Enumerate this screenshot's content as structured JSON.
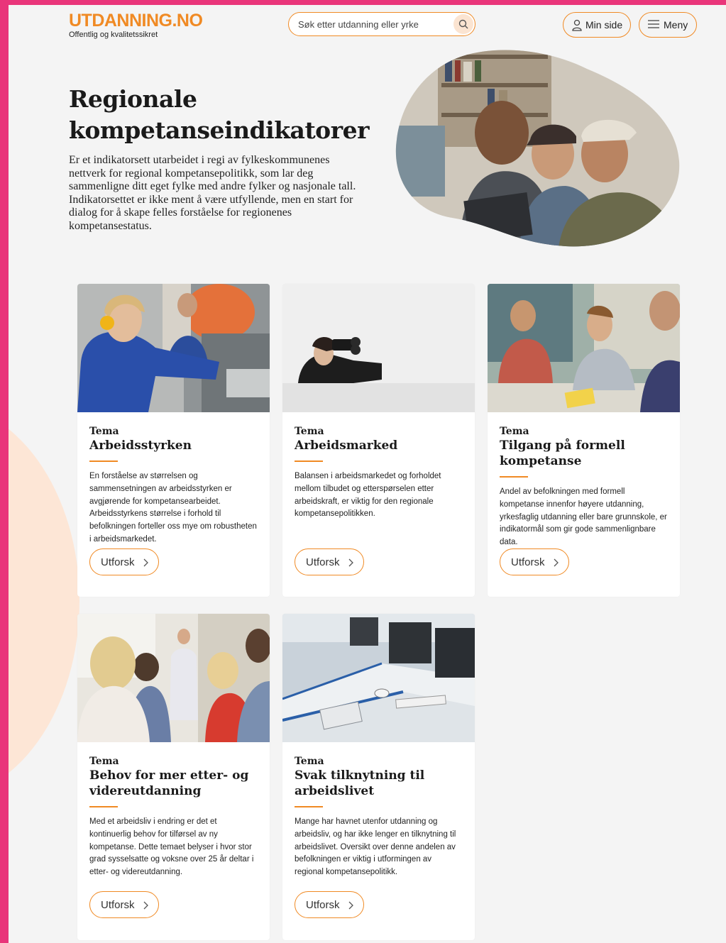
{
  "header": {
    "logo": "UTDANNING.NO",
    "tagline": "Offentlig og kvalitetssikret",
    "search_placeholder": "Søk etter utdanning eller yrke",
    "min_side_label": "Min side",
    "menu_label": "Meny"
  },
  "hero": {
    "title": "Regionale kompetanseindikatorer",
    "text": "Er et indikatorsett utarbeidet i regi av fylkeskommunenes nettverk for regional kompetansepolitikk, som lar deg sammenligne ditt eget fylke med andre fylker og nasjonale tall. Indikatorsettet er ikke ment å være utfyllende, men en start for dialog for å skape felles forståelse for regionenes kompetansestatus."
  },
  "cards": [
    {
      "tag": "Tema",
      "title": "Arbeidsstyrken",
      "text": "En forståelse av størrelsen og sammensetningen av arbeidsstyrken er avgjørende for kompetansearbeidet. Arbeidsstyrkens størrelse i forhold til befolkningen forteller oss mye om robustheten i arbeidsmarkedet.",
      "button": "Utforsk"
    },
    {
      "tag": "Tema",
      "title": "Arbeidsmarked",
      "text": "Balansen i arbeidsmarkedet og forholdet mellom tilbudet og etterspørselen etter arbeidskraft, er viktig for den regionale kompetansepolitikken.",
      "button": "Utforsk"
    },
    {
      "tag": "Tema",
      "title": "Tilgang på formell kompetanse",
      "text": "Andel av befolkningen med formell kompetanse innenfor høyere utdanning, yrkesfaglig utdanning eller bare grunnskole, er indikatormål som gir gode sammenlignbare data.",
      "button": "Utforsk"
    },
    {
      "tag": "Tema",
      "title": "Behov for mer etter- og videreutdanning",
      "text": "Med et arbeidsliv i endring er det et kontinuerlig behov for tilførsel av ny kompetanse. Dette temaet belyser i hvor stor grad sysselsatte og voksne over 25 år deltar i etter- og videreutdanning.",
      "button": "Utforsk"
    },
    {
      "tag": "Tema",
      "title": "Svak tilknytning til arbeidslivet",
      "text": "Mange har havnet utenfor utdanning og arbeidsliv, og har ikke lenger en tilknytning til arbeidslivet. Oversikt over denne andelen av befolkningen er viktig i utformingen av regional kompetansepolitikk.",
      "button": "Utforsk"
    }
  ],
  "colors": {
    "accent": "#f08a24",
    "frame": "#e9357a",
    "background": "#f4f4f4"
  }
}
